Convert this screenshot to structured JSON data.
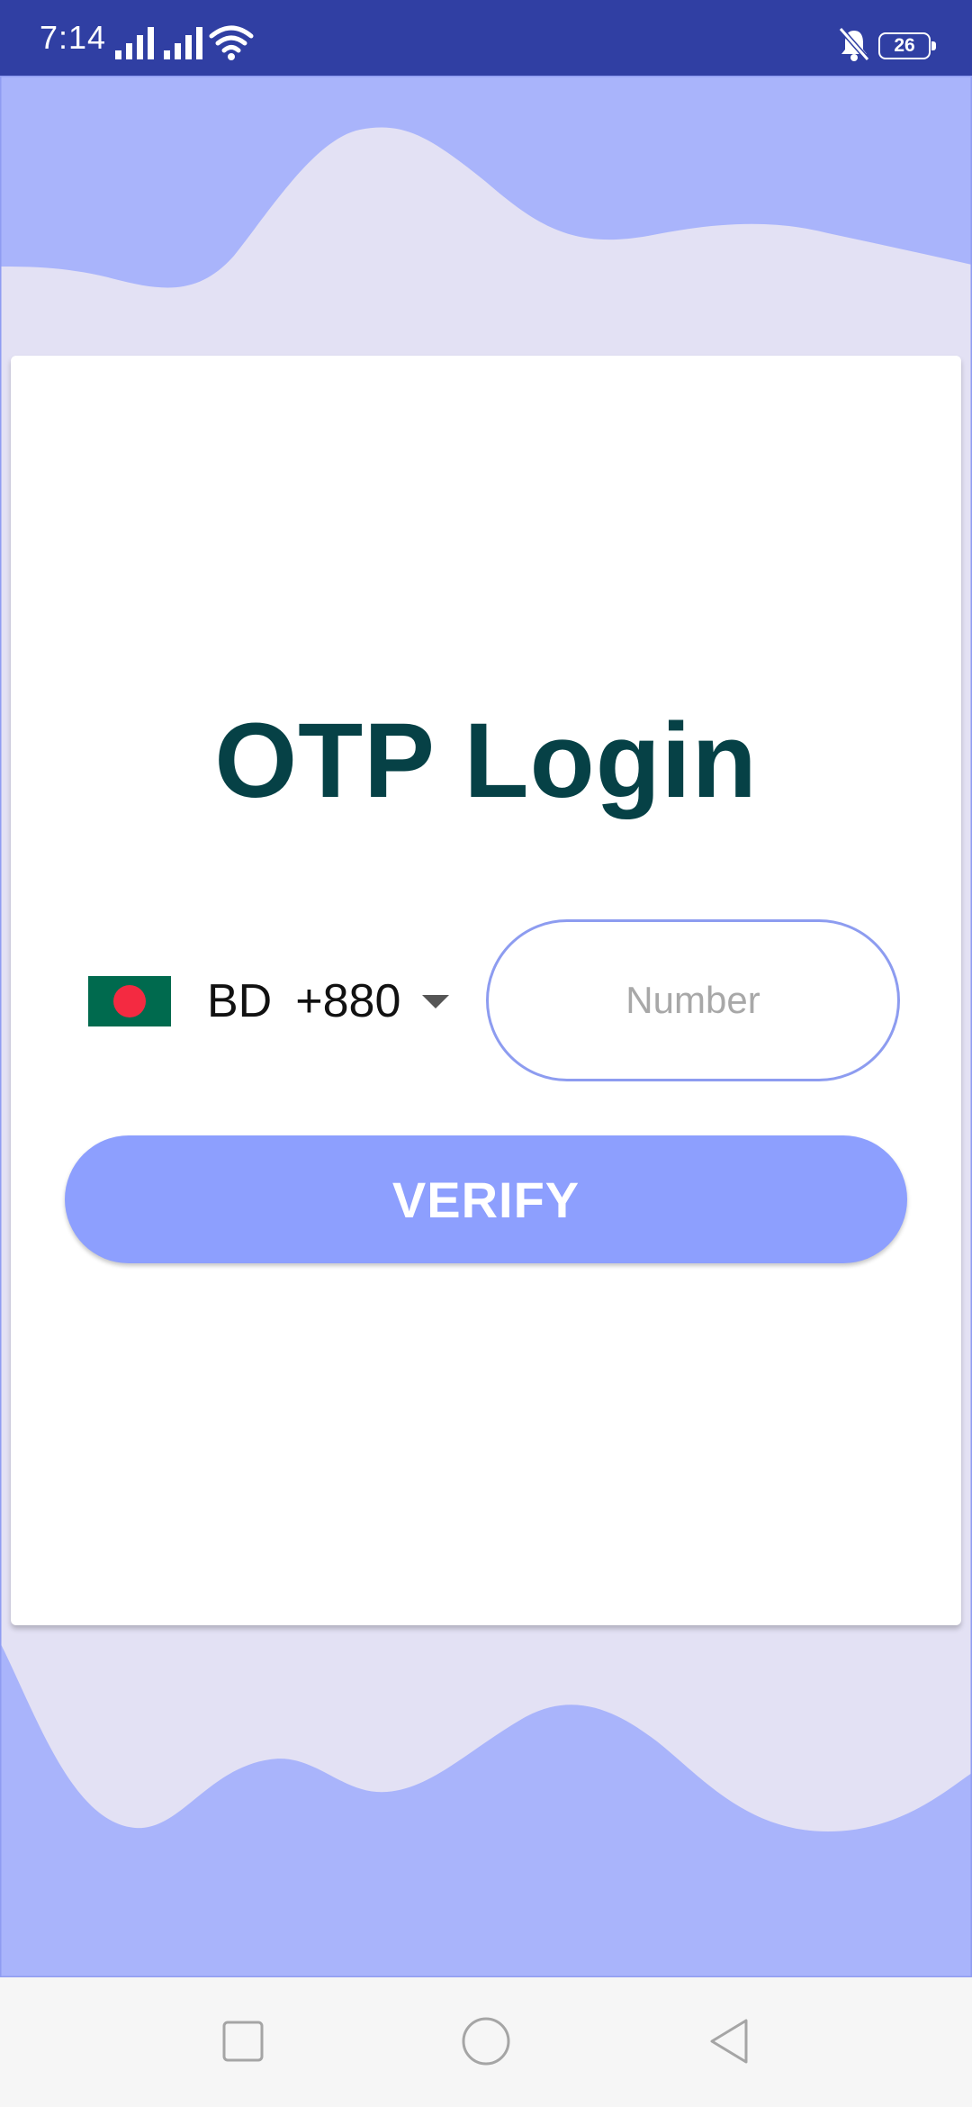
{
  "status_bar": {
    "time": "7:14",
    "battery_level": "26",
    "icons": [
      "signal-icon",
      "signal-icon",
      "wifi-icon",
      "bell-off-icon",
      "battery-icon"
    ]
  },
  "login": {
    "title": "OTP Login",
    "country": {
      "flag": "bangladesh-flag-icon",
      "code": "BD",
      "dial_code": "+880"
    },
    "number_placeholder": "Number",
    "number_value": "",
    "verify_label": "VERIFY"
  },
  "nav_bar": {
    "buttons": [
      "recents-button",
      "home-button",
      "back-button"
    ]
  },
  "colors": {
    "status_bar": "#303fa3",
    "wave_dark": "#a9b4fb",
    "wave_light": "#e3e1f4",
    "title": "#064146",
    "button": "#8d9ffe",
    "input_border": "#8d9cf0"
  }
}
